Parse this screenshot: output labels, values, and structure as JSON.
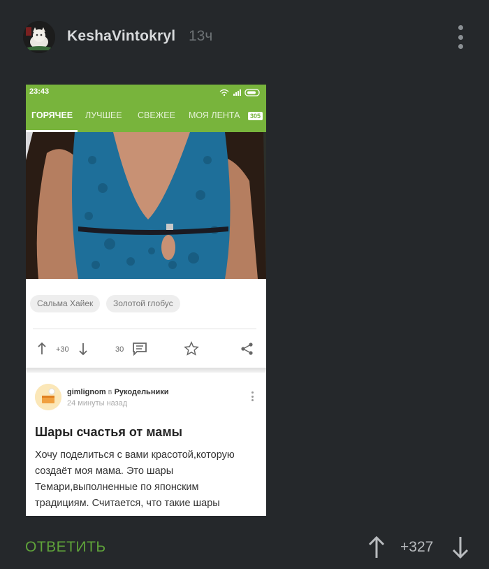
{
  "comment": {
    "username": "KeshaVintokryl",
    "time": "13ч",
    "reply_label": "ОТВЕТИТЬ",
    "score": "+327"
  },
  "screenshot": {
    "status_time": "23:43",
    "tabs": [
      {
        "label": "ГОРЯЧЕЕ",
        "active": true
      },
      {
        "label": "ЛУЧШЕЕ"
      },
      {
        "label": "СВЕЖЕЕ"
      },
      {
        "label": "МОЯ ЛЕНТА"
      }
    ],
    "feed_badge": "305",
    "tags": [
      "Сальма Хайек",
      "Золотой глобус"
    ],
    "rating": "+30",
    "comments_count": "30",
    "post": {
      "author": "gimlignom",
      "in_word": "в",
      "community": "Рукодельники",
      "time": "24 минуты назад",
      "title": "Шары счастья от мамы",
      "body_lines": [
        "Хочу поделиться с вами красотой,которую",
        "создаёт моя мама. Это шары",
        "Темари,выполненные по японским",
        "традициям. Считается, что такие шары"
      ]
    },
    "colors": {
      "brand_green": "#78b43c",
      "reply_green": "#5fa33a"
    }
  },
  "icons": [
    "more-vert-icon",
    "arrow-up-icon",
    "arrow-down-icon",
    "comment-icon",
    "star-icon",
    "share-icon",
    "wifi-icon",
    "signal-icon",
    "battery-icon"
  ]
}
